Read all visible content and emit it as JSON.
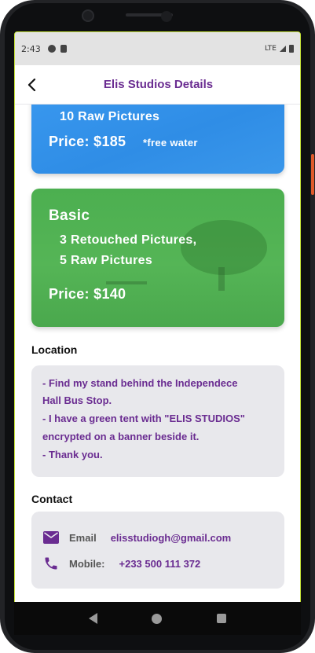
{
  "status_bar": {
    "time": "2:43",
    "network": "LTE"
  },
  "app_bar": {
    "title": "Elis Studios Details"
  },
  "packages": [
    {
      "lines": [
        "10 Raw Pictures"
      ],
      "price": "Price: $185",
      "note": "*free water",
      "color": "#3a96ee"
    },
    {
      "name": "Basic",
      "lines": [
        "3 Retouched Pictures,",
        "5 Raw Pictures"
      ],
      "price": "Price: $140",
      "color": "#4caf50"
    }
  ],
  "location": {
    "heading": "Location",
    "lines": [
      "- Find my stand behind the Independece",
      "Hall Bus Stop.",
      "- I have a green tent with \"ELIS STUDIOS\"",
      "encrypted on a banner beside it.",
      "- Thank you."
    ]
  },
  "contact": {
    "heading": "Contact",
    "email_label": "Email",
    "email_value": "elisstudiogh@gmail.com",
    "email_icon": "mail-icon",
    "phone_label": "Mobile:",
    "phone_value": "+233 500 111 372",
    "phone_icon": "phone-icon"
  },
  "colors": {
    "accent": "#6a2c91",
    "panel": "#e8e8ec"
  }
}
